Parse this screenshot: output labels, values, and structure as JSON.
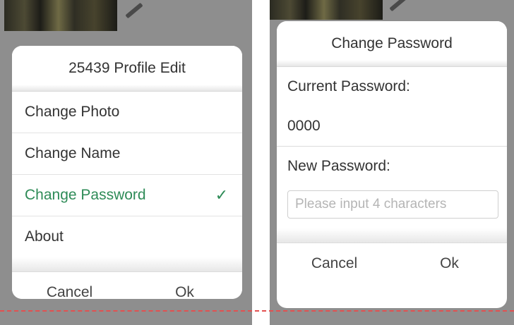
{
  "profile_dialog": {
    "title": "25439 Profile Edit",
    "items": [
      {
        "label": "Change Photo"
      },
      {
        "label": "Change Name"
      },
      {
        "label": "Change Password",
        "checkmark": "✓"
      },
      {
        "label": "About"
      }
    ],
    "cancel_label": "Cancel",
    "ok_label": "Ok"
  },
  "password_dialog": {
    "title": "Change Password",
    "current_label": "Current Password:",
    "current_value": "0000",
    "new_label": "New Password:",
    "new_placeholder": "Please input 4 characters",
    "cancel_label": "Cancel",
    "ok_label": "Ok"
  },
  "colors": {
    "accent": "#2e8b57",
    "guide_line": "#e35050",
    "backdrop": "#8e8e8e"
  },
  "icons": [
    "pencil-icon",
    "check-icon"
  ]
}
